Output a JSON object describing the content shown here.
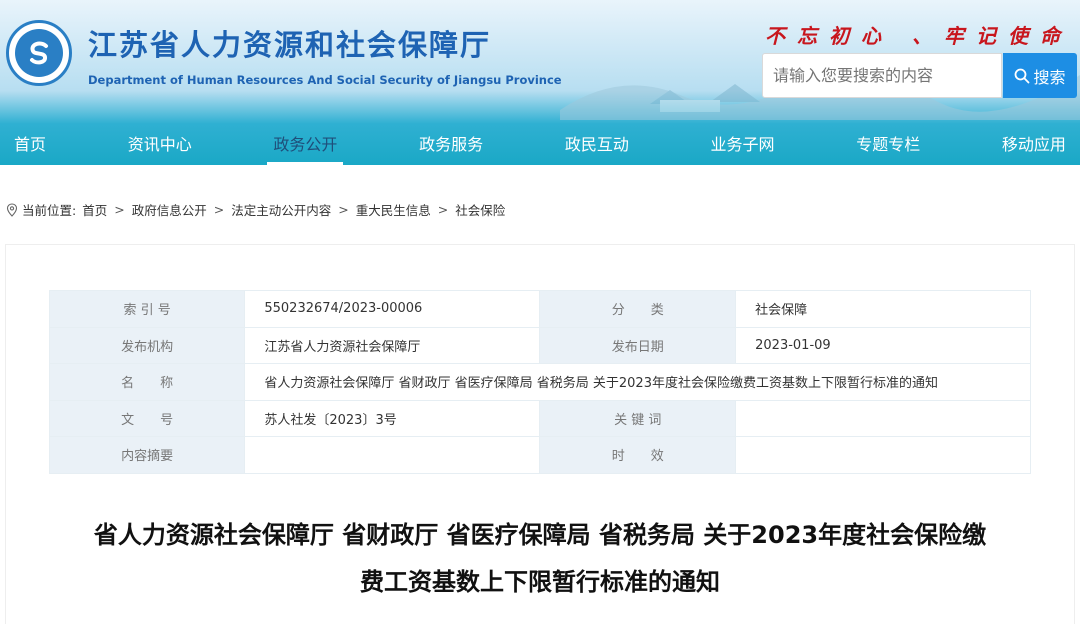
{
  "header": {
    "title_cn": "江苏省人力资源和社会保障厅",
    "title_en": "Department of Human Resources And Social Security of Jiangsu Province",
    "slogan": "不忘初心 、牢记使命",
    "logo_icon": "agency-seal-icon"
  },
  "search": {
    "placeholder": "请输入您要搜索的内容",
    "button_label": "搜索",
    "button_color": "#1d8ee4"
  },
  "nav": {
    "items": [
      "首页",
      "资讯中心",
      "政务公开",
      "政务服务",
      "政民互动",
      "业务子网",
      "专题专栏",
      "移动应用"
    ],
    "active_index": 2
  },
  "breadcrumb": {
    "prefix": "当前位置:",
    "items": [
      "首页",
      "政府信息公开",
      "法定主动公开内容",
      "重大民生信息",
      "社会保险"
    ],
    "separator": ">"
  },
  "meta": {
    "index_label": "索 引 号",
    "index_value": "550232674/2023-00006",
    "category_label": "分　　类",
    "category_value": "社会保障",
    "publisher_label": "发布机构",
    "publisher_value": "江苏省人力资源社会保障厅",
    "date_label": "发布日期",
    "date_value": "2023-01-09",
    "name_label": "名　　称",
    "name_value": "省人力资源社会保障厅 省财政厅 省医疗保障局 省税务局 关于2023年度社会保险缴费工资基数上下限暂行标准的通知",
    "doc_no_label": "文　　号",
    "doc_no_value": "苏人社发〔2023〕3号",
    "keywords_label": "关 键 词",
    "keywords_value": "",
    "summary_label": "内容摘要",
    "summary_value": "",
    "validity_label": "时　　效",
    "validity_value": ""
  },
  "document": {
    "title_line1": "省人力资源社会保障厅 省财政厅 省医疗保障局 省税务局 关于2023年度社会保险缴",
    "title_line2": "费工资基数上下限暂行标准的通知"
  },
  "colors": {
    "brand_blue": "#1e63b3",
    "slogan_red": "#c8161d",
    "nav_teal": "#1aa8c6"
  }
}
